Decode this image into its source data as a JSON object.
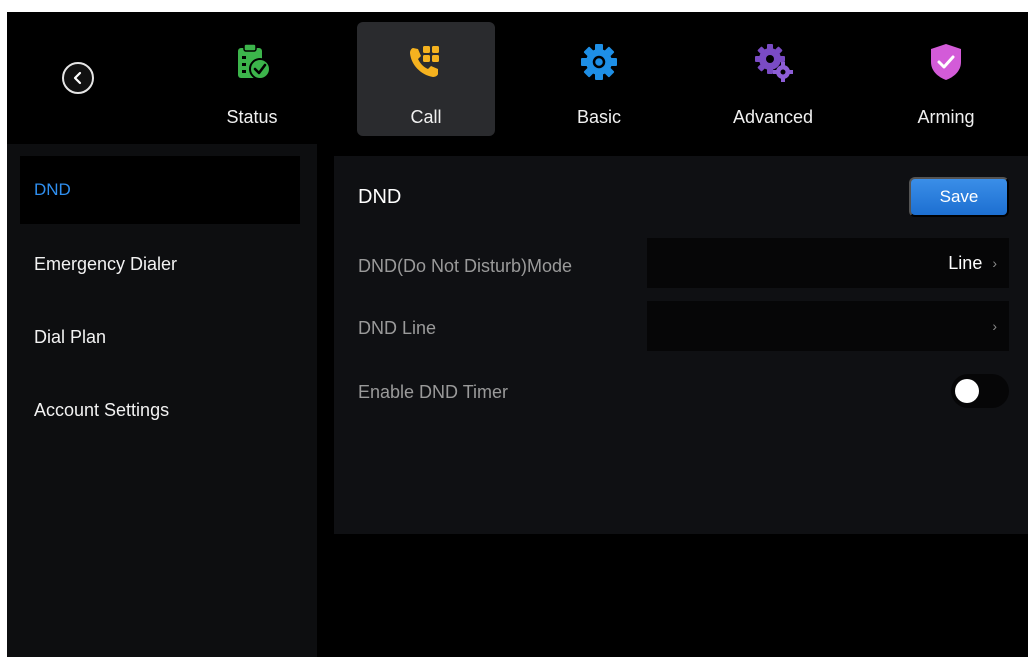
{
  "nav": {
    "items": [
      {
        "label": "Status",
        "icon": "clipboard-check-icon",
        "color": "#3cb44b"
      },
      {
        "label": "Call",
        "icon": "phone-dialpad-icon",
        "color": "#f5b21f"
      },
      {
        "label": "Basic",
        "icon": "gear-icon",
        "color": "#1e8fe6"
      },
      {
        "label": "Advanced",
        "icon": "gears-icon",
        "color": "#7a4bc4"
      },
      {
        "label": "Arming",
        "icon": "shield-check-icon",
        "color": "#d35bd8"
      }
    ],
    "active": "Call"
  },
  "sidebar": {
    "items": [
      {
        "label": "DND"
      },
      {
        "label": "Emergency Dialer"
      },
      {
        "label": "Dial Plan"
      },
      {
        "label": "Account Settings"
      }
    ],
    "active": "DND"
  },
  "panel": {
    "title": "DND",
    "save_label": "Save",
    "rows": [
      {
        "label": "DND(Do Not Disturb)Mode",
        "value": "Line"
      },
      {
        "label": "DND Line",
        "value": ""
      },
      {
        "label": "Enable DND Timer",
        "toggle": "off"
      }
    ]
  },
  "colors": {
    "accent": "#2f8ff0",
    "background": "#000000"
  }
}
